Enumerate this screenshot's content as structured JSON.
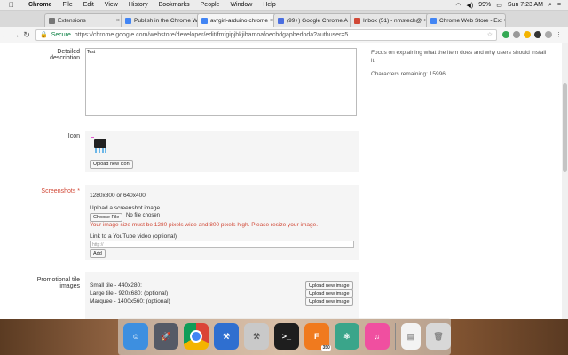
{
  "menubar": {
    "app": "Chrome",
    "items": [
      "File",
      "Edit",
      "View",
      "History",
      "Bookmarks",
      "People",
      "Window",
      "Help"
    ],
    "battery": "99%",
    "clock": "Sun 7:23 AM"
  },
  "tabs": [
    {
      "title": "Extensions",
      "color": "#777"
    },
    {
      "title": "Publish in the Chrome W",
      "color": "#4285f4"
    },
    {
      "title": "avrgirl-arduino chrome",
      "color": "#4285f4"
    },
    {
      "title": "(99+) Google Chrome A",
      "color": "#4a6ee0"
    },
    {
      "title": "Inbox (51) - nmstech@",
      "color": "#d14836"
    },
    {
      "title": "Chrome Web Store - Ext",
      "color": "#4285f4"
    }
  ],
  "toolbar": {
    "secure": "Secure",
    "url": "https://chrome.google.com/webstore/developer/edit/fmfgipjhkjibamoafoecbdgapbedoda?authuser=5"
  },
  "form": {
    "detailed_label_1": "Detailed",
    "detailed_label_2": "description",
    "description_value": "Test",
    "help_text": "Focus on explaining what the item does and why users should install it.",
    "chars_remaining": "Characters remaining: 15996",
    "icon_label": "Icon",
    "upload_icon": "Upload new icon",
    "screenshots_label": "Screenshots *",
    "size_hint": "1280x800 or 640x400",
    "upload_screenshot": "Upload a screenshot image",
    "choose_file": "Choose File",
    "no_file": "No file chosen",
    "error": "Your image size must be 1280 pixels wide and 800 pixels high. Please resize your image.",
    "youtube_label": "Link to a YouTube video (optional)",
    "youtube_placeholder": "http://",
    "add": "Add",
    "promo_label_1": "Promotional tile",
    "promo_label_2": "images",
    "small_tile": "Small tile - 440x280:",
    "large_tile": "Large tile - 920x680: (optional)",
    "marquee": "Marquee - 1400x560: (optional)",
    "upload_image": "Upload new image"
  },
  "dock": {
    "apps": [
      {
        "name": "finder-app",
        "color": "#3d8fe0",
        "label": ""
      },
      {
        "name": "launchpad-app",
        "color": "#555a66",
        "label": ""
      },
      {
        "name": "chrome-app",
        "color": "#e8e8e8",
        "label": ""
      },
      {
        "name": "xcode-app",
        "color": "#2f6fd0",
        "label": ""
      },
      {
        "name": "git-tower-app",
        "color": "#c9c9c9",
        "label": ""
      },
      {
        "name": "terminal-app",
        "color": "#1e1e1e",
        "label": ">_"
      },
      {
        "name": "fusion-app",
        "color": "#f07a1e",
        "label": "F"
      },
      {
        "name": "atom-app",
        "color": "#3aa58a",
        "label": ""
      },
      {
        "name": "itunes-app",
        "color": "#f04fa0",
        "label": "♫"
      },
      {
        "name": "file-app",
        "color": "#f3f3f3",
        "label": ""
      },
      {
        "name": "trash-app",
        "color": "#d8d8d8",
        "label": ""
      }
    ],
    "badge": "350"
  }
}
